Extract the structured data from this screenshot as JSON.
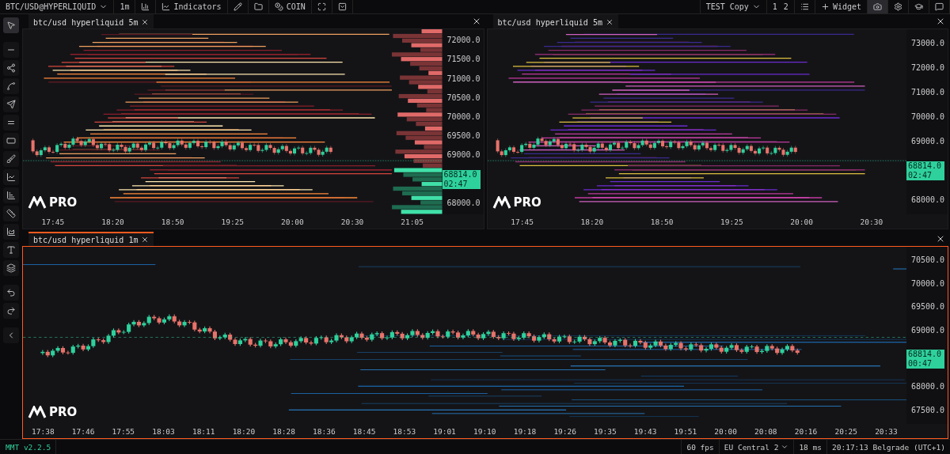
{
  "toolbar": {
    "symbol": "BTC/USD@HYPERLIQUID",
    "interval": "1m",
    "indicators": "Indicators",
    "coin": "COIN",
    "layout": "TEST Copy",
    "pages": [
      {
        "label": "1",
        "selected": false
      },
      {
        "label": "2",
        "selected": false
      }
    ],
    "widget": "Widget"
  },
  "tools": [
    {
      "kind": "cursor",
      "selected": true
    },
    {
      "kind": "hline",
      "selected": false
    },
    {
      "kind": "nodes",
      "selected": false
    },
    {
      "kind": "path",
      "selected": false
    },
    {
      "kind": "arrow",
      "selected": false
    },
    {
      "kind": "parallel",
      "selected": false
    },
    {
      "kind": "rect",
      "selected": false
    },
    {
      "kind": "brush",
      "selected": false
    },
    {
      "kind": "chart",
      "selected": false
    },
    {
      "kind": "bars",
      "selected": false
    },
    {
      "kind": "ruler",
      "selected": false
    },
    {
      "kind": "area",
      "selected": false
    },
    {
      "kind": "text",
      "selected": false
    },
    {
      "kind": "layers",
      "selected": false
    },
    {
      "kind": "undo",
      "selected": false
    },
    {
      "kind": "redo",
      "selected": false
    },
    {
      "kind": "collapse",
      "selected": false
    }
  ],
  "panels": [
    {
      "tab": "btc/usd hyperliquid 5m",
      "active": false,
      "prices": [
        "72000.0",
        "71500.0",
        "71000.0",
        "70500.0",
        "70000.0",
        "69500.0",
        "69000.0",
        "68000.0"
      ],
      "times": [
        "17:45",
        "18:20",
        "18:50",
        "19:25",
        "20:00",
        "20:30",
        "21:05"
      ],
      "last_price": "68814.0",
      "countdown": "02:47",
      "logo": "PRO"
    },
    {
      "tab": "btc/usd hyperliquid 5m",
      "active": false,
      "prices": [
        "73000.0",
        "72000.0",
        "71000.0",
        "70000.0",
        "69000.0",
        "68000.0"
      ],
      "times": [
        "17:45",
        "18:20",
        "18:50",
        "19:25",
        "20:00",
        "20:30"
      ],
      "last_price": "68814.0",
      "countdown": "02:47",
      "logo": "PRO"
    },
    {
      "tab": "btc/usd hyperliquid 1m",
      "active": true,
      "prices": [
        "70500.0",
        "70000.0",
        "69500.0",
        "69000.0",
        "68000.0",
        "67500.0"
      ],
      "times": [
        "17:38",
        "17:46",
        "17:55",
        "18:03",
        "18:11",
        "18:20",
        "18:28",
        "18:36",
        "18:45",
        "18:53",
        "19:01",
        "19:10",
        "19:18",
        "19:26",
        "19:35",
        "19:43",
        "19:51",
        "20:00",
        "20:08",
        "20:16",
        "20:25",
        "20:33"
      ],
      "last_price": "68814.0",
      "countdown": "00:47",
      "logo": "PRO"
    }
  ],
  "status": {
    "version": "MMT v2.2.5",
    "fps": "60 fps",
    "region": "EU Central 2",
    "latency": "18 ms",
    "clock": "20:17:13 Belgrade (UTC+1)"
  }
}
